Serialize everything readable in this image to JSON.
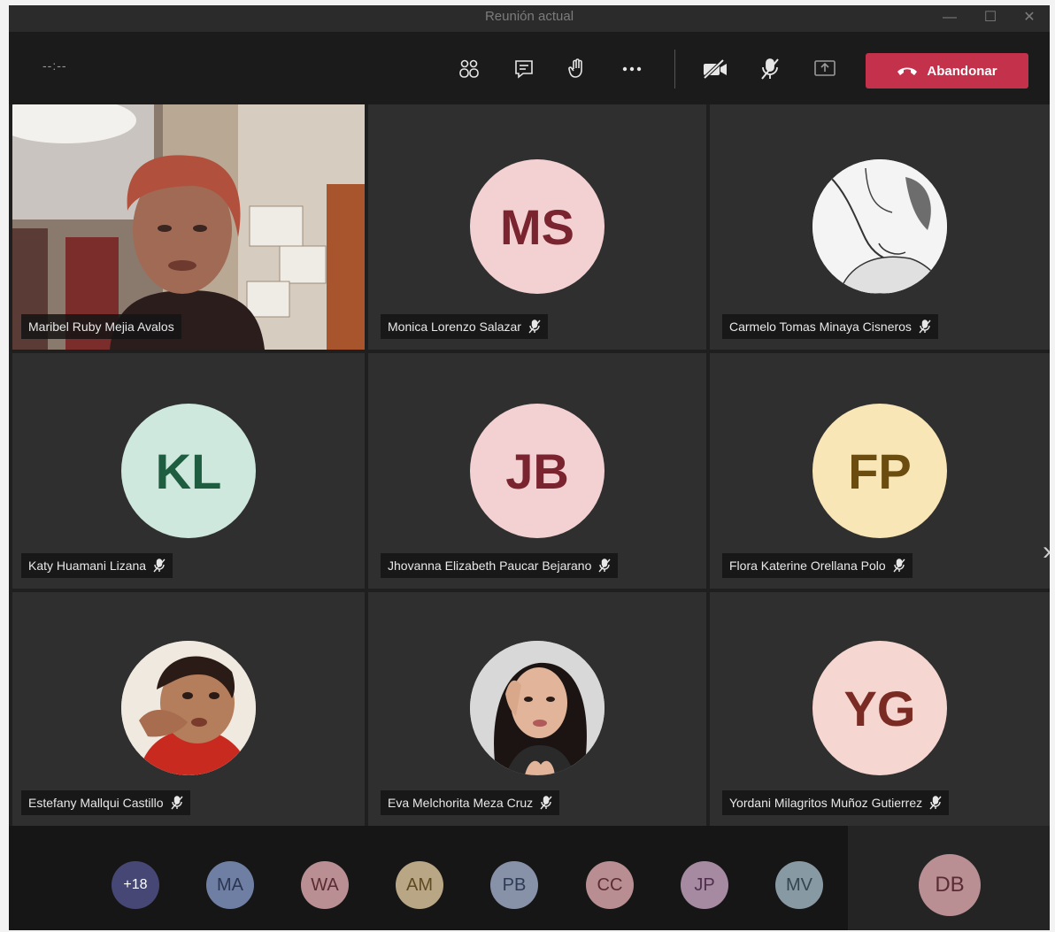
{
  "window": {
    "title": "Reunión actual",
    "minimize": "—",
    "maximize": "☐",
    "close": "✕"
  },
  "toolbar": {
    "timer": "--:--",
    "leave_label": "Abandonar"
  },
  "colors": {
    "leave": "#c4314b",
    "tile_bg": "#2f2f2f",
    "toolbar_bg": "#1b1b1b"
  },
  "participants": [
    {
      "name": "Maribel Ruby Mejia Avalos",
      "type": "video"
    },
    {
      "name": "Monica Lorenzo Salazar",
      "initials": "MS",
      "bg": "#f3d1d3",
      "fg": "#7a2430",
      "type": "initials"
    },
    {
      "name": "Carmelo Tomas Minaya Cisneros",
      "type": "photo-sketch"
    },
    {
      "name": "Katy Huamani Lizana",
      "initials": "KL",
      "bg": "#cfe8de",
      "fg": "#1f5d40",
      "type": "initials"
    },
    {
      "name": "Jhovanna Elizabeth Paucar Bejarano",
      "initials": "JB",
      "bg": "#f3d1d3",
      "fg": "#7a2430",
      "type": "initials"
    },
    {
      "name": "Flora Katerine Orellana Polo",
      "initials": "FP",
      "bg": "#f8e6b6",
      "fg": "#6b4d10",
      "type": "initials"
    },
    {
      "name": "Estefany Mallqui Castillo",
      "type": "photo-child"
    },
    {
      "name": "Eva Melchorita Meza Cruz",
      "type": "photo-girl"
    },
    {
      "name": "Yordani Milagritos Muñoz Gutierrez",
      "initials": "YG",
      "bg": "#f6d6d0",
      "fg": "#7a2c24",
      "type": "initials"
    }
  ],
  "overflow": [
    {
      "label": "+18",
      "bg": "#464775",
      "fg": "#ffffff"
    },
    {
      "label": "MA",
      "bg": "#6f7ea3",
      "fg": "#2b3550"
    },
    {
      "label": "WA",
      "bg": "#b98f94",
      "fg": "#5a2b33"
    },
    {
      "label": "AM",
      "bg": "#b9a684",
      "fg": "#5e4a22"
    },
    {
      "label": "PB",
      "bg": "#8792a9",
      "fg": "#2f3a55"
    },
    {
      "label": "CC",
      "bg": "#b88e92",
      "fg": "#5c2c32"
    },
    {
      "label": "JP",
      "bg": "#a58aa2",
      "fg": "#4f2f4c"
    },
    {
      "label": "MV",
      "bg": "#8799a3",
      "fg": "#33464f"
    }
  ],
  "self_view": {
    "label": "DB",
    "bg": "#b98f94",
    "fg": "#5a2b33"
  }
}
